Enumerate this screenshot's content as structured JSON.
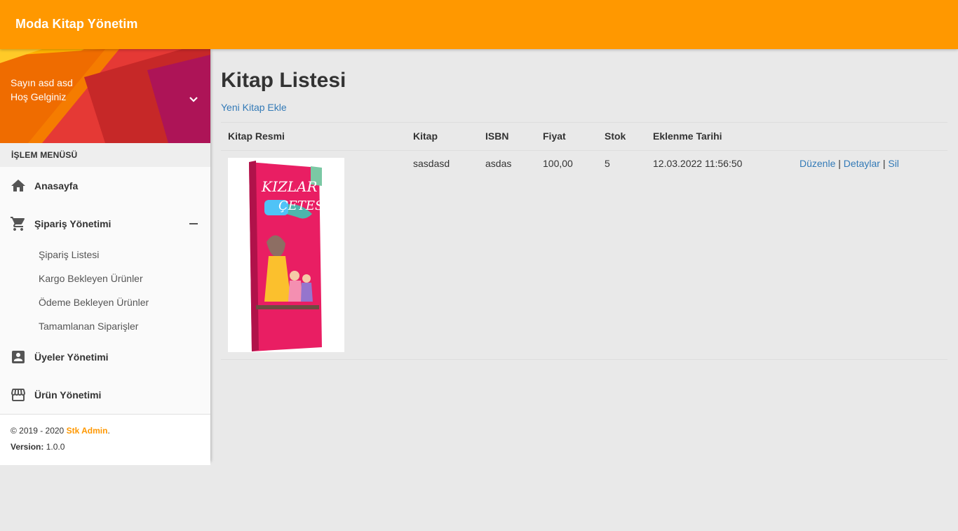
{
  "app": {
    "brand": "Moda Kitap Yönetim"
  },
  "user": {
    "greeting_name": "Sayın asd asd",
    "welcome": "Hoş Gelginiz"
  },
  "sidebar": {
    "menu_header": "İŞLEM MENÜSÜ",
    "items": [
      {
        "label": "Anasayfa",
        "icon": "home-icon"
      },
      {
        "label": "Şipariş Yönetimi",
        "icon": "cart-icon",
        "expanded": true,
        "subitems": [
          "Şipariş Listesi",
          "Kargo Bekleyen Ürünler",
          "Ödeme Bekleyen Ürünler",
          "Tamamlanan Siparişler"
        ]
      },
      {
        "label": "Üyeler Yönetimi",
        "icon": "account-box-icon"
      },
      {
        "label": "Ürün Yönetimi",
        "icon": "store-icon"
      }
    ],
    "footer": {
      "copyright": "© 2019 - 2020 ",
      "brand_link": "Stk Admin",
      "period": ".",
      "version_label": "Version:",
      "version_value": " 1.0.0"
    }
  },
  "main": {
    "title": "Kitap Listesi",
    "new_link": "Yeni Kitap Ekle",
    "table": {
      "columns": [
        "Kitap Resmi",
        "Kitap",
        "ISBN",
        "Fiyat",
        "Stok",
        "Eklenme Tarihi",
        ""
      ],
      "rows": [
        {
          "book": "sasdasd",
          "isbn": "asdas",
          "price": "100,00",
          "stock": "5",
          "added": "12.03.2022 11:56:50",
          "cover_title_1": "KIZLAR",
          "cover_title_2": "ÇETESİ",
          "actions": {
            "edit": "Düzenle",
            "details": "Detaylar",
            "delete": "Sil",
            "sep": " | "
          }
        }
      ]
    }
  },
  "colors": {
    "topbar": "#ff9800",
    "link": "#337ab7",
    "accent": "#ff9800",
    "cover": "#e91e63"
  }
}
